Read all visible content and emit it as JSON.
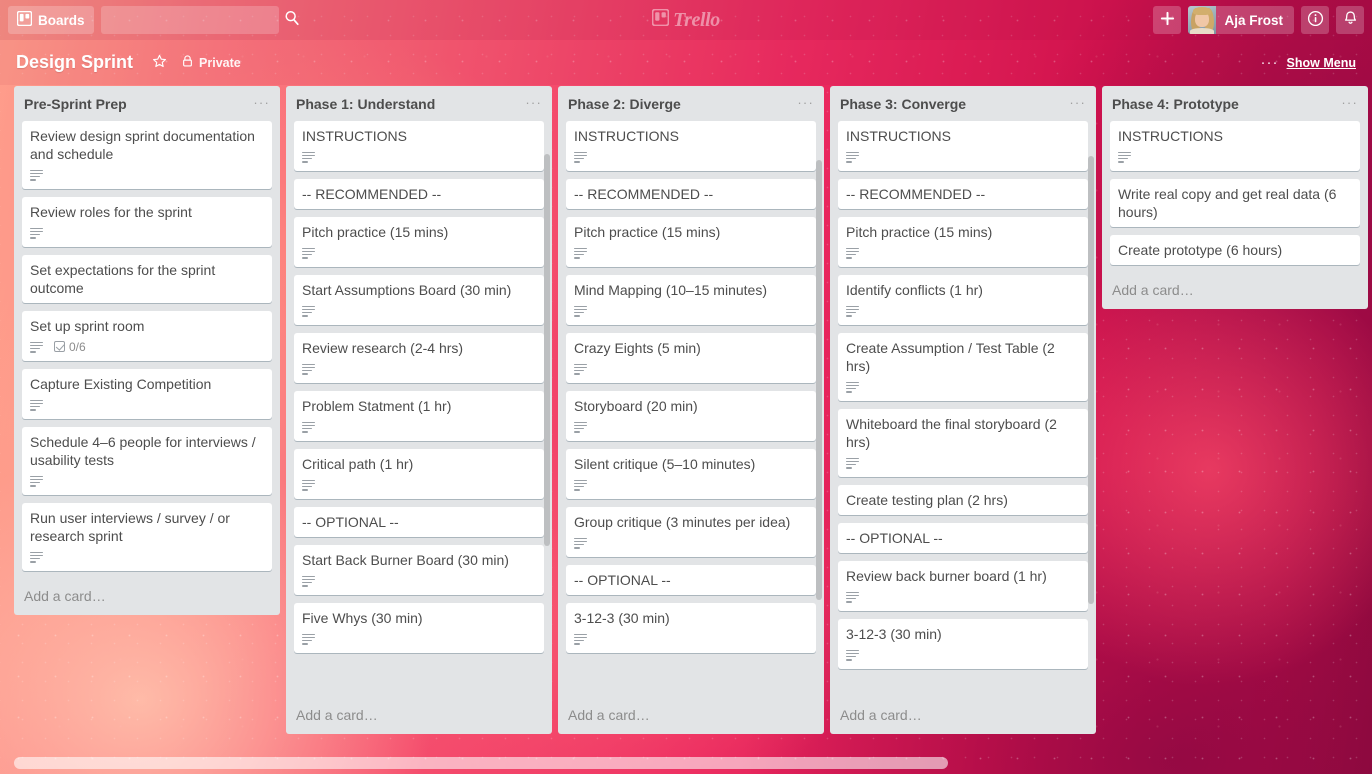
{
  "topbar": {
    "boards_label": "Boards",
    "boards_icon": "board-icon",
    "search_placeholder": "",
    "search_value": "",
    "search_icon": "search-icon",
    "add_label": "+",
    "member_name": "Aja Frost",
    "info_icon": "info-icon",
    "notifications_icon": "bell-icon",
    "logo_text": "Trello",
    "logo_icon": "trello-board-icon"
  },
  "board_header": {
    "title": "Design Sprint",
    "star_icon": "star-icon",
    "visibility_icon": "lock-icon",
    "visibility_label": "Private",
    "dots_label": "···",
    "show_menu_label": "Show Menu"
  },
  "add_card_label": "Add a card…",
  "list_menu_label": "···",
  "lists": [
    {
      "title": "Pre-Sprint Prep",
      "cards": [
        {
          "title": "Review design sprint documentation and schedule",
          "desc": true,
          "checklist": null
        },
        {
          "title": "Review roles for the sprint",
          "desc": true,
          "checklist": null
        },
        {
          "title": "Set expectations for the sprint outcome",
          "desc": false,
          "checklist": null
        },
        {
          "title": "Set up sprint room",
          "desc": true,
          "checklist": "0/6"
        },
        {
          "title": "Capture Existing Competition",
          "desc": true,
          "checklist": null
        },
        {
          "title": "Schedule 4–6 people for interviews / usability tests",
          "desc": true,
          "checklist": null
        },
        {
          "title": "Run user interviews / survey / or research sprint",
          "desc": true,
          "checklist": null
        }
      ]
    },
    {
      "title": "Phase 1: Understand",
      "cards": [
        {
          "title": "INSTRUCTIONS",
          "desc": true,
          "checklist": null
        },
        {
          "title": "-- RECOMMENDED --",
          "desc": false,
          "checklist": null
        },
        {
          "title": "Pitch practice (15 mins)",
          "desc": true,
          "checklist": null
        },
        {
          "title": "Start Assumptions Board (30 min)",
          "desc": true,
          "checklist": null
        },
        {
          "title": "Review research (2-4 hrs)",
          "desc": true,
          "checklist": null
        },
        {
          "title": "Problem Statment (1 hr)",
          "desc": true,
          "checklist": null
        },
        {
          "title": "Critical path (1 hr)",
          "desc": true,
          "checklist": null
        },
        {
          "title": "-- OPTIONAL --",
          "desc": false,
          "checklist": null
        },
        {
          "title": "Start Back Burner Board (30 min)",
          "desc": true,
          "checklist": null
        },
        {
          "title": "Five Whys (30 min)",
          "desc": true,
          "checklist": null
        }
      ]
    },
    {
      "title": "Phase 2: Diverge",
      "cards": [
        {
          "title": "INSTRUCTIONS",
          "desc": true,
          "checklist": null
        },
        {
          "title": "-- RECOMMENDED --",
          "desc": false,
          "checklist": null
        },
        {
          "title": "Pitch practice (15 mins)",
          "desc": true,
          "checklist": null
        },
        {
          "title": "Mind Mapping (10–15 minutes)",
          "desc": true,
          "checklist": null
        },
        {
          "title": "Crazy Eights (5 min)",
          "desc": true,
          "checklist": null
        },
        {
          "title": "Storyboard (20 min)",
          "desc": true,
          "checklist": null
        },
        {
          "title": "Silent critique (5–10 minutes)",
          "desc": true,
          "checklist": null
        },
        {
          "title": "Group critique (3 minutes per idea)",
          "desc": true,
          "checklist": null
        },
        {
          "title": "-- OPTIONAL --",
          "desc": false,
          "checklist": null
        },
        {
          "title": "3-12-3 (30 min)",
          "desc": true,
          "checklist": null
        }
      ]
    },
    {
      "title": "Phase 3: Converge",
      "cards": [
        {
          "title": "INSTRUCTIONS",
          "desc": true,
          "checklist": null
        },
        {
          "title": "-- RECOMMENDED --",
          "desc": false,
          "checklist": null
        },
        {
          "title": "Pitch practice (15 mins)",
          "desc": true,
          "checklist": null
        },
        {
          "title": "Identify conflicts (1 hr)",
          "desc": true,
          "checklist": null
        },
        {
          "title": "Create Assumption / Test Table (2 hrs)",
          "desc": true,
          "checklist": null
        },
        {
          "title": "Whiteboard the final storyboard (2 hrs)",
          "desc": true,
          "checklist": null
        },
        {
          "title": "Create testing plan (2 hrs)",
          "desc": false,
          "checklist": null
        },
        {
          "title": "-- OPTIONAL --",
          "desc": false,
          "checklist": null
        },
        {
          "title": "Review back burner board (1 hr)",
          "desc": true,
          "checklist": null
        },
        {
          "title": "3-12-3 (30 min)",
          "desc": true,
          "checklist": null
        }
      ]
    },
    {
      "title": "Phase 4: Prototype",
      "cards": [
        {
          "title": "INSTRUCTIONS",
          "desc": true,
          "checklist": null
        },
        {
          "title": "Write real copy and get real data (6 hours)",
          "desc": false,
          "checklist": null
        },
        {
          "title": "Create prototype (6 hours)",
          "desc": false,
          "checklist": null
        }
      ]
    }
  ],
  "colors": {
    "board_bg_accent": "#e5386b",
    "list_bg": "#e2e4e6",
    "card_bg": "#ffffff",
    "text": "#4d4d4d",
    "muted": "#8c8c8c"
  }
}
